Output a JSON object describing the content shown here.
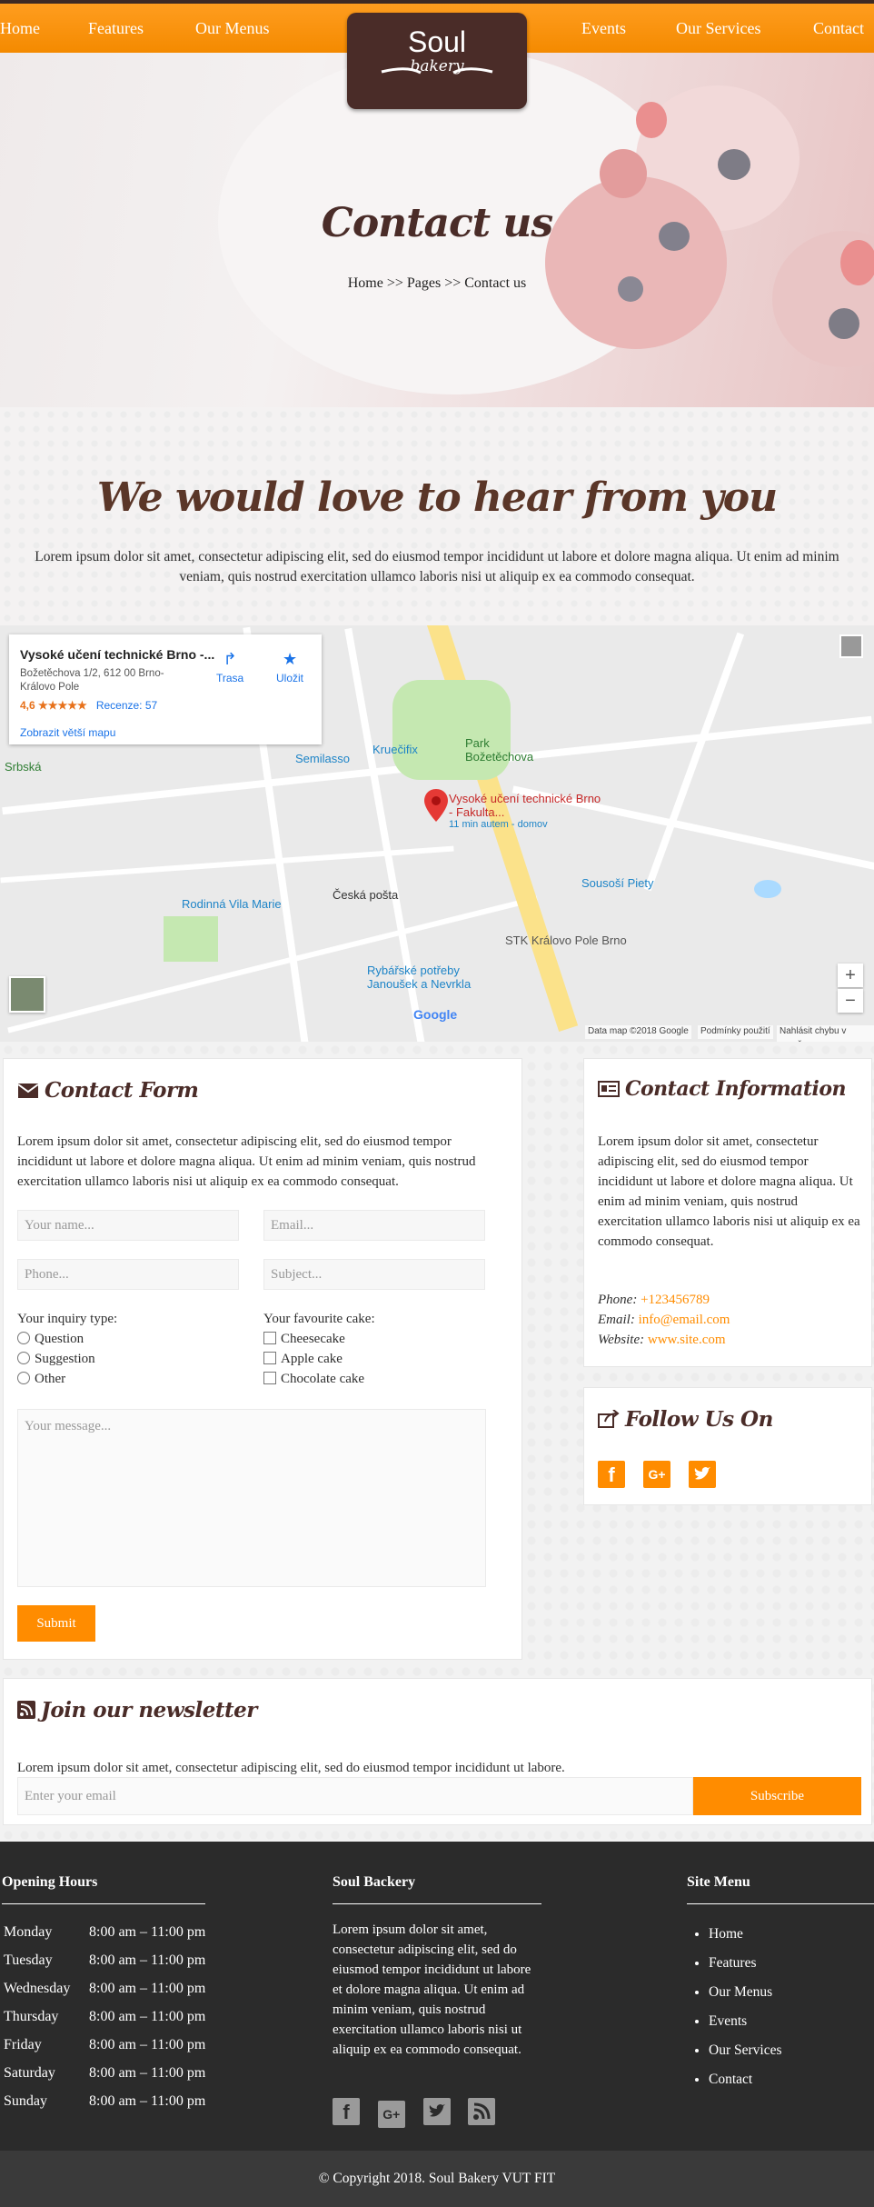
{
  "nav": {
    "home": "Home",
    "features": "Features",
    "menus": "Our Menus",
    "events": "Events",
    "services": "Our Services",
    "contact": "Contact"
  },
  "logo": {
    "line1": "Soul",
    "line2": "bakery"
  },
  "hero": {
    "title": "Contact us",
    "breadcrumb": "Home >> Pages >> Contact us"
  },
  "intro": {
    "heading": "We would love to hear from you",
    "text": "Lorem ipsum dolor sit amet, consectetur adipiscing elit, sed do eiusmod tempor incididunt ut labore et dolore magna aliqua. Ut enim ad minim veniam, quis nostrud exercitation ullamco laboris nisi ut aliquip ex ea commodo consequat."
  },
  "map": {
    "place_title": "Vysoké učení technické Brno -...",
    "address": "Božetěchova 1/2, 612 00 Brno-Královo Pole",
    "rating": "4,6 ★★★★★",
    "reviews": "Recenze: 57",
    "larger_map": "Zobrazit větší mapu",
    "directions": "Trasa",
    "save": "Uložit",
    "pin_label": "Vysoké učení technické Brno - Fakulta...",
    "pin_sub": "11 min autem - domov",
    "labels": [
      "Semilasso",
      "Kruečifix",
      "Park Božetěchova",
      "Rodinná Vila Marie",
      "Česká pošta",
      "Sousoší Piety",
      "STK Královo Pole Brno",
      "Rybářské potřeby Janoušek a Nevrkla",
      "Srbská"
    ],
    "attribution": "Data map ©2018 Google",
    "terms": "Podmínky použití",
    "report": "Nahlásit chybu v mapě",
    "google": "Google",
    "zoom_in": "+",
    "zoom_out": "−"
  },
  "contact_form": {
    "title": "Contact Form",
    "text": "Lorem ipsum dolor sit amet, consectetur adipiscing elit, sed do eiusmod tempor incididunt ut labore et dolore magna aliqua. Ut enim ad minim veniam, quis nostrud exercitation ullamco laboris nisi ut aliquip ex ea commodo consequat.",
    "name_ph": "Your name...",
    "email_ph": "Email...",
    "phone_ph": "Phone...",
    "subject_ph": "Subject...",
    "inquiry_label": "Your inquiry type:",
    "inquiry_options": [
      "Question",
      "Suggestion",
      "Other"
    ],
    "cake_label": "Your favourite cake:",
    "cake_options": [
      "Cheesecake",
      "Apple cake",
      "Chocolate cake"
    ],
    "message_ph": "Your message...",
    "submit": "Submit"
  },
  "contact_info": {
    "title": "Contact Information",
    "text": "Lorem ipsum dolor sit amet, consectetur adipiscing elit, sed do eiusmod tempor incididunt ut labore et dolore magna aliqua. Ut enim ad minim veniam, quis nostrud exercitation ullamco laboris nisi ut aliquip ex ea commodo consequat.",
    "phone_label": "Phone:",
    "phone": "+123456789",
    "email_label": "Email:",
    "email": "info@email.com",
    "website_label": "Website:",
    "website": "www.site.com"
  },
  "follow": {
    "title": "Follow Us On"
  },
  "newsletter": {
    "title": "Join our newsletter",
    "text": "Lorem ipsum dolor sit amet, consectetur adipiscing elit, sed do eiusmod tempor incididunt ut labore.",
    "placeholder": "Enter your email",
    "button": "Subscribe"
  },
  "footer": {
    "hours_title": "Opening Hours",
    "hours": [
      [
        "Monday",
        "8:00 am – 11:00 pm"
      ],
      [
        "Tuesday",
        "8:00 am – 11:00 pm"
      ],
      [
        "Wednesday",
        "8:00 am – 11:00 pm"
      ],
      [
        "Thursday",
        "8:00 am – 11:00 pm"
      ],
      [
        "Friday",
        "8:00 am – 11:00 pm"
      ],
      [
        "Saturday",
        "8:00 am – 11:00 pm"
      ],
      [
        "Sunday",
        "8:00 am – 11:00 pm"
      ]
    ],
    "about_title": "Soul Backery",
    "about_text": "Lorem ipsum dolor sit amet, consectetur adipiscing elit, sed do eiusmod tempor incididunt ut labore et dolore magna aliqua. Ut enim ad minim veniam, quis nostrud exercitation ullamco laboris nisi ut aliquip ex ea commodo consequat.",
    "sitemap_title": "Site Menu",
    "sitemap": [
      "Home",
      "Features",
      "Our Menus",
      "Events",
      "Our Services",
      "Contact"
    ],
    "copyright": "© Copyright 2018. Soul Bakery VUT FIT"
  },
  "colors": {
    "accent": "#ff8c00",
    "brown": "#4a2c28",
    "footer_bg": "#2b2b2b"
  }
}
